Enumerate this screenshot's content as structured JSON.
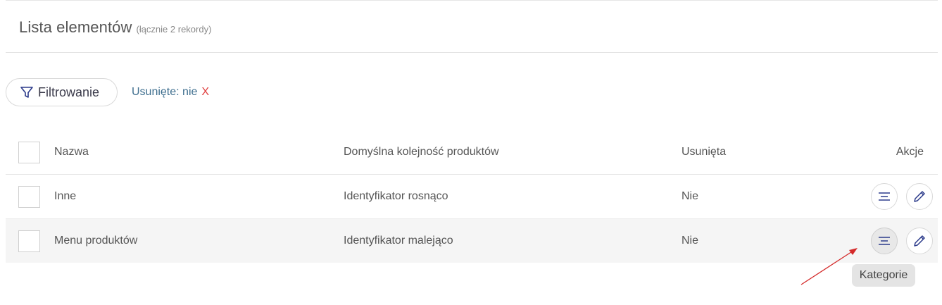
{
  "header": {
    "title": "Lista elementów",
    "count": "(łącznie 2 rekordy)"
  },
  "filter": {
    "button_label": "Filtrowanie",
    "active": {
      "label": "Usunięte: nie",
      "remove": "X"
    }
  },
  "table": {
    "columns": {
      "name": "Nazwa",
      "order": "Domyślna kolejność produktów",
      "deleted": "Usunięta",
      "actions": "Akcje"
    },
    "rows": [
      {
        "name": "Inne",
        "order": "Identyfikator rosnąco",
        "deleted": "Nie"
      },
      {
        "name": "Menu produktów",
        "order": "Identyfikator malejąco",
        "deleted": "Nie"
      }
    ]
  },
  "tooltip": "Kategorie",
  "icons": {
    "filter": "funnel-icon",
    "categories": "list-lines-icon",
    "edit": "pencil-icon"
  },
  "colors": {
    "accent": "#2b3a8a",
    "filter_text": "#3f6f8f",
    "remove": "#e04040",
    "arrow": "#d42a2a"
  }
}
